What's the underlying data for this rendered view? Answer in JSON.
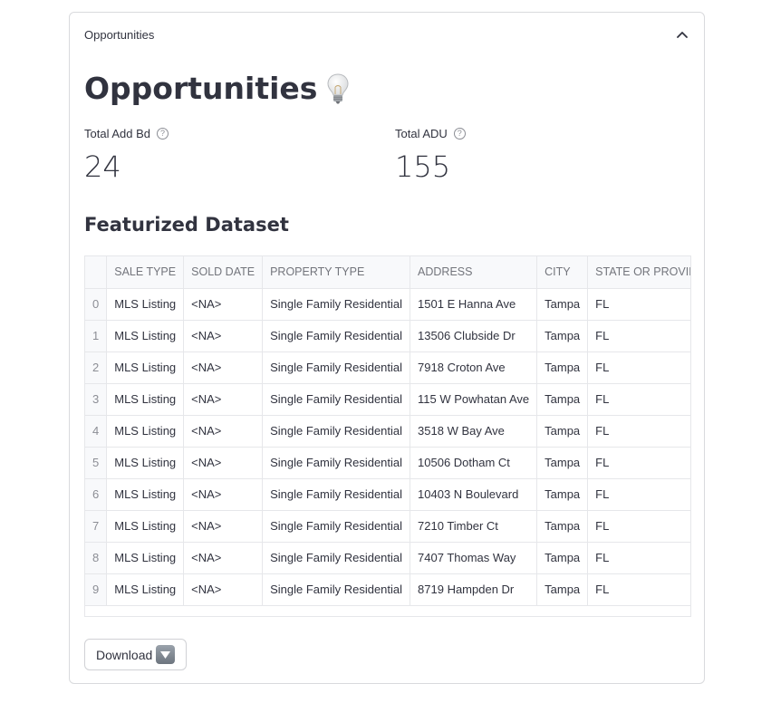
{
  "expander": {
    "label": "Opportunities"
  },
  "page": {
    "title": "Opportunities",
    "title_icon": "lightbulb-icon"
  },
  "metrics": [
    {
      "label": "Total Add Bd",
      "value": "24"
    },
    {
      "label": "Total ADU",
      "value": "155"
    }
  ],
  "dataset": {
    "title": "Featurized Dataset",
    "columns": [
      "",
      "SALE TYPE",
      "SOLD DATE",
      "PROPERTY TYPE",
      "ADDRESS",
      "CITY",
      "STATE OR PROVIN"
    ],
    "rows": [
      [
        "0",
        "MLS Listing",
        "<NA>",
        "Single Family Residential",
        "1501 E Hanna Ave",
        "Tampa",
        "FL"
      ],
      [
        "1",
        "MLS Listing",
        "<NA>",
        "Single Family Residential",
        "13506 Clubside Dr",
        "Tampa",
        "FL"
      ],
      [
        "2",
        "MLS Listing",
        "<NA>",
        "Single Family Residential",
        "7918 Croton Ave",
        "Tampa",
        "FL"
      ],
      [
        "3",
        "MLS Listing",
        "<NA>",
        "Single Family Residential",
        "115 W Powhatan Ave",
        "Tampa",
        "FL"
      ],
      [
        "4",
        "MLS Listing",
        "<NA>",
        "Single Family Residential",
        "3518 W Bay Ave",
        "Tampa",
        "FL"
      ],
      [
        "5",
        "MLS Listing",
        "<NA>",
        "Single Family Residential",
        "10506 Dotham Ct",
        "Tampa",
        "FL"
      ],
      [
        "6",
        "MLS Listing",
        "<NA>",
        "Single Family Residential",
        "10403 N Boulevard",
        "Tampa",
        "FL"
      ],
      [
        "7",
        "MLS Listing",
        "<NA>",
        "Single Family Residential",
        "7210 Timber Ct",
        "Tampa",
        "FL"
      ],
      [
        "8",
        "MLS Listing",
        "<NA>",
        "Single Family Residential",
        "7407 Thomas Way",
        "Tampa",
        "FL"
      ],
      [
        "9",
        "MLS Listing",
        "<NA>",
        "Single Family Residential",
        "8719 Hampden Dr",
        "Tampa",
        "FL"
      ]
    ]
  },
  "download": {
    "label": "Download",
    "icon": "down-arrow-icon"
  }
}
